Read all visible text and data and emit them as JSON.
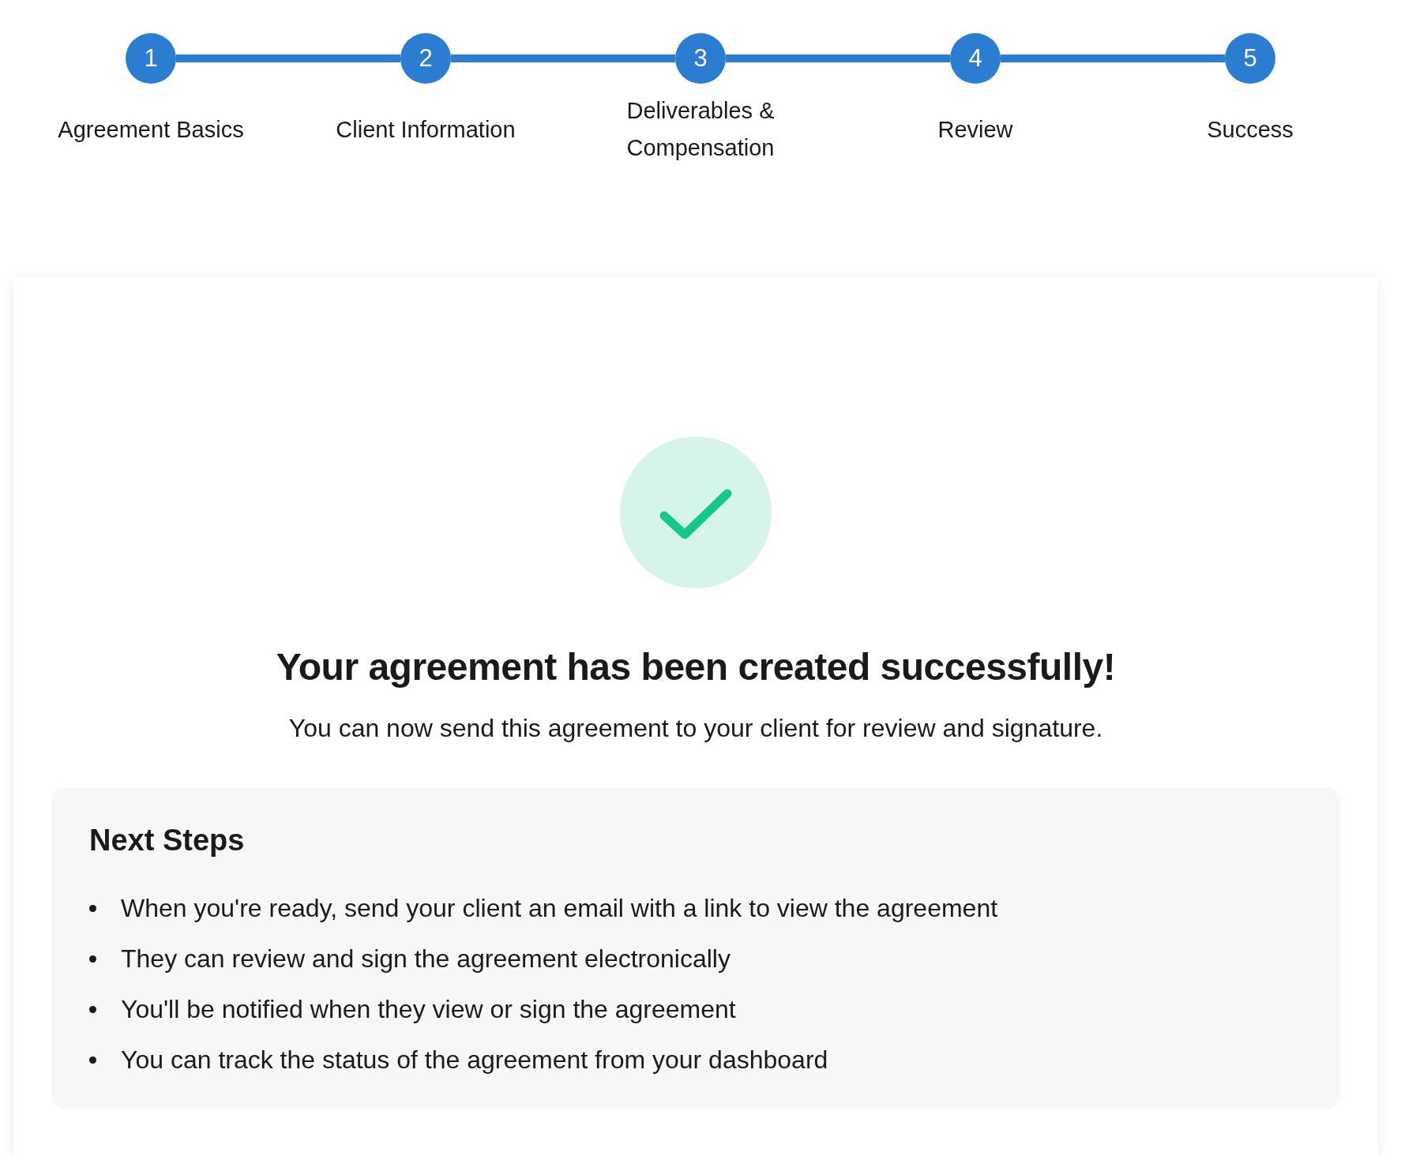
{
  "steps": [
    {
      "number": "1",
      "label": "Agreement Basics",
      "completed": true
    },
    {
      "number": "2",
      "label": "Client Information",
      "completed": true
    },
    {
      "number": "3",
      "label": "Deliverables & Compensation",
      "completed": true
    },
    {
      "number": "4",
      "label": "Review",
      "completed": true
    },
    {
      "number": "5",
      "label": "Success",
      "completed": true
    }
  ],
  "success": {
    "heading": "Your agreement has been created successfully!",
    "message": "You can now send this agreement to your client for review and signature."
  },
  "next_steps": {
    "title": "Next Steps",
    "items": [
      "When you're ready, send your client an email with a link to view the agreement",
      "They can review and sign the agreement electronically",
      "You'll be notified when they view or sign the agreement",
      "You can track the status of the agreement from your dashboard"
    ]
  }
}
